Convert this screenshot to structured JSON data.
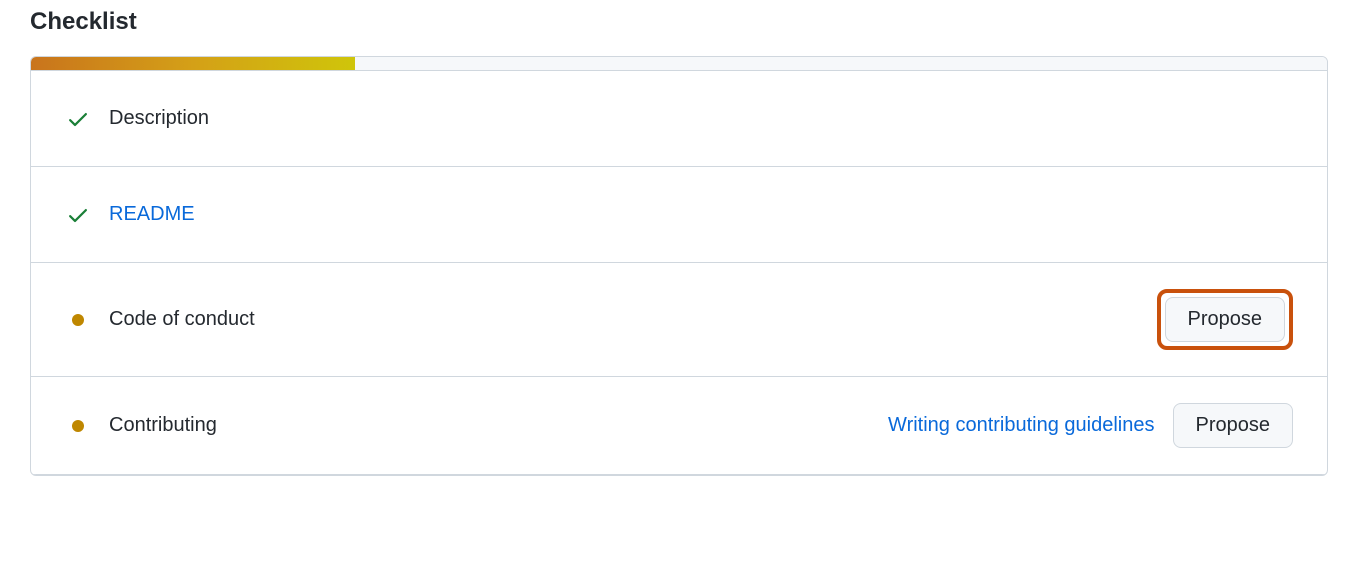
{
  "heading": "Checklist",
  "progress_percent": 25,
  "items": [
    {
      "label": "Description",
      "status": "done",
      "is_link": false
    },
    {
      "label": "README",
      "status": "done",
      "is_link": true
    },
    {
      "label": "Code of conduct",
      "status": "pending",
      "propose": "Propose",
      "highlighted": true
    },
    {
      "label": "Contributing",
      "status": "pending",
      "help_link": "Writing contributing guidelines",
      "propose": "Propose",
      "highlighted": false
    }
  ]
}
